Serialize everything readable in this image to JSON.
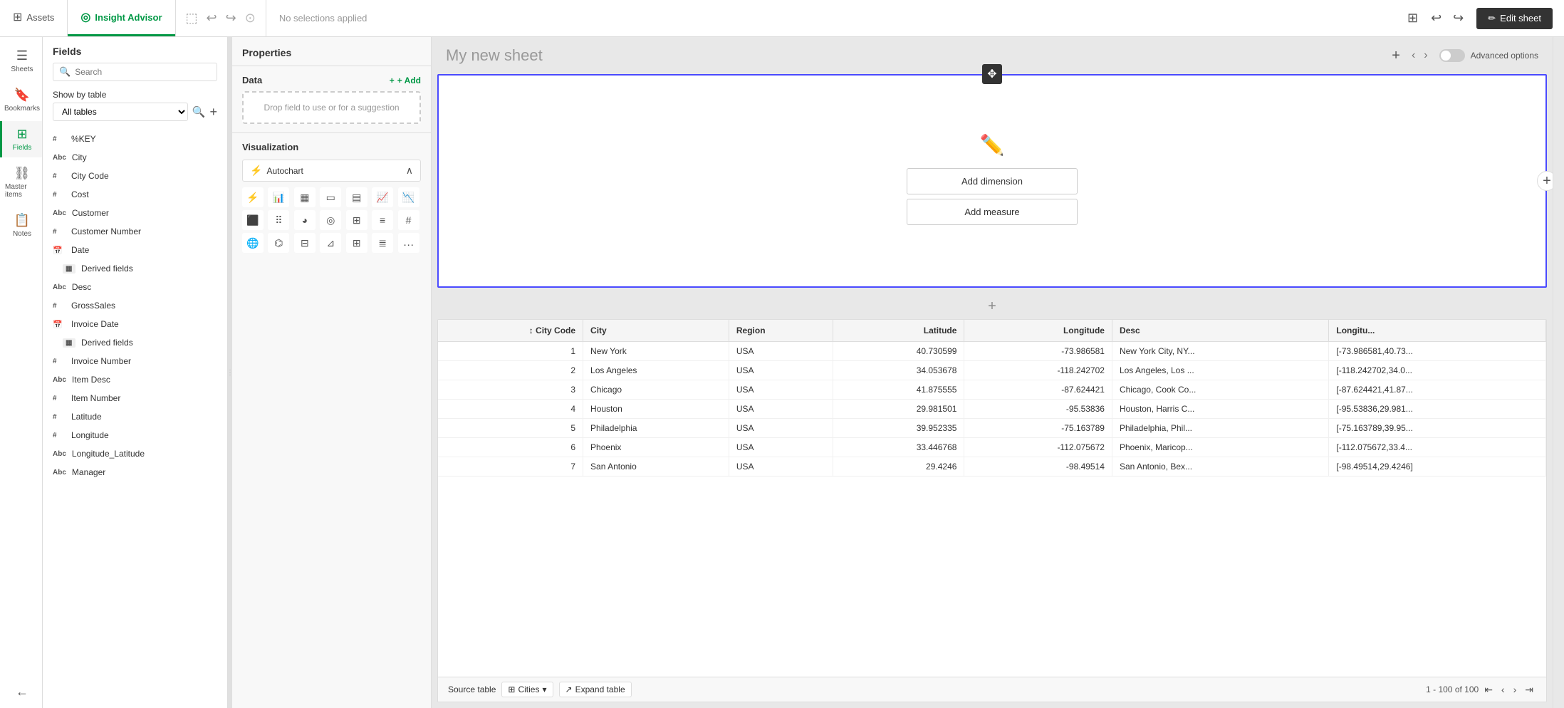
{
  "topbar": {
    "assets_label": "Assets",
    "insight_advisor_label": "Insight Advisor",
    "no_selections_label": "No selections applied",
    "edit_sheet_label": "Edit sheet"
  },
  "sidebar": {
    "sheets_label": "Sheets",
    "bookmarks_label": "Bookmarks",
    "fields_label": "Fields",
    "master_items_label": "Master items",
    "notes_label": "Notes"
  },
  "fields_panel": {
    "title": "Fields",
    "search_placeholder": "Search",
    "show_by_table_label": "Show by table",
    "all_tables_option": "All tables",
    "fields": [
      {
        "type": "#",
        "name": "%KEY"
      },
      {
        "type": "Abc",
        "name": "City"
      },
      {
        "type": "#",
        "name": "City Code"
      },
      {
        "type": "#",
        "name": "Cost"
      },
      {
        "type": "Abc",
        "name": "Customer"
      },
      {
        "type": "#",
        "name": "Customer Number"
      },
      {
        "type": "cal",
        "name": "Date"
      },
      {
        "type": "derived",
        "name": "Derived fields",
        "sub": true
      },
      {
        "type": "Abc",
        "name": "Desc"
      },
      {
        "type": "#",
        "name": "GrossSales"
      },
      {
        "type": "cal",
        "name": "Invoice Date"
      },
      {
        "type": "derived",
        "name": "Derived fields",
        "sub": true
      },
      {
        "type": "#",
        "name": "Invoice Number"
      },
      {
        "type": "Abc",
        "name": "Item Desc"
      },
      {
        "type": "#",
        "name": "Item Number"
      },
      {
        "type": "#",
        "name": "Latitude"
      },
      {
        "type": "#",
        "name": "Longitude"
      },
      {
        "type": "Abc",
        "name": "Longitude_Latitude"
      },
      {
        "type": "Abc",
        "name": "Manager"
      }
    ]
  },
  "properties": {
    "title": "Properties",
    "data_label": "Data",
    "add_label": "+ Add",
    "drop_hint": "Drop field to use or for a suggestion",
    "visualization_label": "Visualization",
    "autochart_label": "Autochart"
  },
  "sheet": {
    "title": "My new sheet",
    "add_dimension_label": "Add dimension",
    "add_measure_label": "Add measure",
    "advanced_options_label": "Advanced options"
  },
  "table": {
    "columns": [
      {
        "key": "city_code",
        "label": "City Code",
        "align": "num",
        "icon": "sort"
      },
      {
        "key": "city",
        "label": "City",
        "align": "left"
      },
      {
        "key": "region",
        "label": "Region",
        "align": "left"
      },
      {
        "key": "latitude",
        "label": "Latitude",
        "align": "num"
      },
      {
        "key": "longitude",
        "label": "Longitude",
        "align": "num"
      },
      {
        "key": "desc",
        "label": "Desc",
        "align": "left"
      },
      {
        "key": "longitu",
        "label": "Longitu...",
        "align": "left"
      }
    ],
    "rows": [
      {
        "city_code": "1",
        "city": "New York",
        "region": "USA",
        "latitude": "40.730599",
        "longitude": "-73.986581",
        "desc": "New York City, NY...",
        "longitu": "[-73.986581,40.73..."
      },
      {
        "city_code": "2",
        "city": "Los Angeles",
        "region": "USA",
        "latitude": "34.053678",
        "longitude": "-118.242702",
        "desc": "Los Angeles, Los ...",
        "longitu": "[-118.242702,34.0..."
      },
      {
        "city_code": "3",
        "city": "Chicago",
        "region": "USA",
        "latitude": "41.875555",
        "longitude": "-87.624421",
        "desc": "Chicago, Cook Co...",
        "longitu": "[-87.624421,41.87..."
      },
      {
        "city_code": "4",
        "city": "Houston",
        "region": "USA",
        "latitude": "29.981501",
        "longitude": "-95.53836",
        "desc": "Houston, Harris C...",
        "longitu": "[-95.53836,29.981..."
      },
      {
        "city_code": "5",
        "city": "Philadelphia",
        "region": "USA",
        "latitude": "39.952335",
        "longitude": "-75.163789",
        "desc": "Philadelphia, Phil...",
        "longitu": "[-75.163789,39.95..."
      },
      {
        "city_code": "6",
        "city": "Phoenix",
        "region": "USA",
        "latitude": "33.446768",
        "longitude": "-112.075672",
        "desc": "Phoenix, Maricop...",
        "longitu": "[-112.075672,33.4..."
      },
      {
        "city_code": "7",
        "city": "San Antonio",
        "region": "USA",
        "latitude": "29.4246",
        "longitude": "-98.49514",
        "desc": "San Antonio, Bex...",
        "longitu": "[-98.49514,29.4246]"
      }
    ],
    "source_label": "Source table",
    "source_table": "Cities",
    "expand_label": "Expand table",
    "pagination_info": "1 - 100 of 100"
  }
}
